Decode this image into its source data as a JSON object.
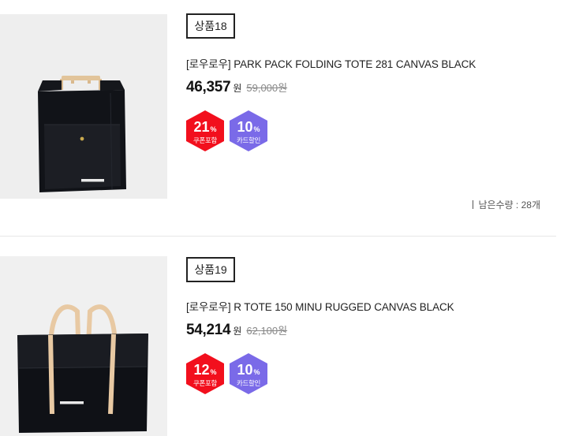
{
  "products": [
    {
      "tag": "상품18",
      "name": "[로우로우] PARK PACK FOLDING TOTE 281 CANVAS BLACK",
      "price": "46,357",
      "currency": "원",
      "original_price": "59,000원",
      "coupon_badge": {
        "percent": "21",
        "pct_sign": "%",
        "label": "쿠폰포함",
        "color": "#f20f1d"
      },
      "card_badge": {
        "percent": "10",
        "pct_sign": "%",
        "label": "카드할인",
        "color": "#7a6ae8"
      },
      "stock_text": "남은수량 : 28개",
      "image_icon": "tote-bag-handles-icon"
    },
    {
      "tag": "상품19",
      "name": "[로우로우] R TOTE 150 MINU RUGGED CANVAS BLACK",
      "price": "54,214",
      "currency": "원",
      "original_price": "62,100원",
      "coupon_badge": {
        "percent": "12",
        "pct_sign": "%",
        "label": "쿠폰포함",
        "color": "#f20f1d"
      },
      "card_badge": {
        "percent": "10",
        "pct_sign": "%",
        "label": "카드할인",
        "color": "#7a6ae8"
      },
      "image_icon": "tote-bag-straps-icon"
    }
  ]
}
